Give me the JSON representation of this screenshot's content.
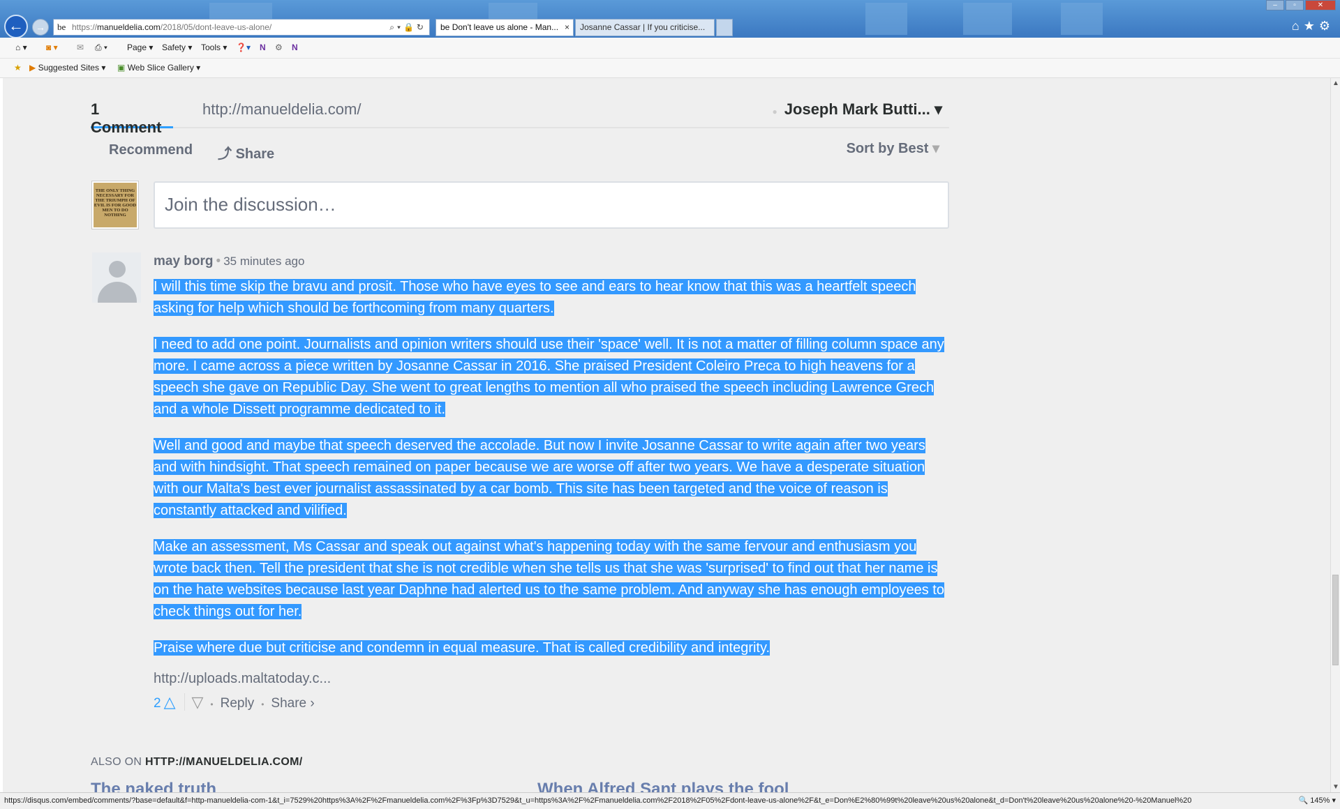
{
  "browser": {
    "address_prefix": "https://",
    "address_main": "manueldelia.com",
    "address_rest": "/2018/05/dont-leave-us-alone/",
    "tabs": [
      {
        "label": "Don't leave us alone - Man..."
      },
      {
        "label": "Josanne Cassar | If you criticise..."
      }
    ],
    "tab_close": "×",
    "favicon_letter": "be",
    "window_buttons": [
      "–",
      "▫",
      "✕"
    ],
    "right_icons": "⌂★⚙"
  },
  "command_bar": {
    "page": "Page",
    "safety": "Safety",
    "tools": "Tools"
  },
  "favorites_bar": {
    "suggested_sites": "Suggested Sites",
    "web_slice_gallery": "Web Slice Gallery"
  },
  "disqus": {
    "comment_count": "1 Comment",
    "site_link": "http://manueldelia.com/",
    "user_name": "Joseph Mark Butti...",
    "recommend": "Recommend",
    "share": "Share",
    "sort": "Sort by Best",
    "composer_placeholder": "Join the discussion…",
    "avatar_quote": "THE ONLY THING NECESSARY FOR THE TRIUMPH OF EVIL IS FOR GOOD MEN TO DO NOTHING",
    "post": {
      "author": "may borg",
      "time": "35 minutes ago",
      "paragraphs": [
        "I will this time skip the bravu and prosit. Those who have eyes to see and ears to hear know that this was a heartfelt speech asking for help which should be forthcoming from many quarters.",
        "I need to add one point. Journalists and opinion writers should use their 'space' well. It is not a matter of filling column space any more. I came across a piece written by Josanne Cassar in 2016. She praised President Coleiro Preca to high heavens for a speech she gave on Republic Day. She went to great lengths to mention all who praised the speech including Lawrence Grech and a whole Dissett programme dedicated to it.",
        "Well and good and maybe that speech deserved the accolade. But now I invite Josanne Cassar to write again after two years and with hindsight. That speech remained on paper because we are worse off after two years. We have a desperate situation with our Malta's best ever journalist assassinated by a car bomb. This site has been targeted and the voice of reason is constantly attacked and vilified.",
        "Make an assessment, Ms Cassar and speak out against what's happening today with the same fervour and enthusiasm you wrote back then. Tell the president that she is not credible when she tells us that she was 'surprised' to find out that her name is on the hate websites because last year Daphne had alerted us to the same problem. And anyway she has enough employees to check things out for her.",
        "Praise where due but criticise and condemn in equal measure. That is called credibility and integrity."
      ],
      "link": "http://uploads.maltatoday.c...",
      "votes": "2",
      "reply": "Reply",
      "share": "Share ›"
    },
    "also_on_prefix": "ALSO ON",
    "also_on_site": "HTTP://MANUELDELIA.COM/",
    "stories": [
      "The naked truth",
      "When Alfred Sant plays the fool"
    ]
  },
  "status_bar": {
    "url": "https://disqus.com/embed/comments/?base=default&f=http-manueldelia-com-1&t_i=7529%20https%3A%2F%2Fmanueldelia.com%2F%3Fp%3D7529&t_u=https%3A%2F%2Fmanueldelia.com%2F2018%2F05%2Fdont-leave-us-alone%2F&t_e=Don%E2%80%99t%20leave%20us%20alone&t_d=Don't%20leave%20us%20alone%20-%20Manuel%20",
    "zoom": "145%"
  },
  "colors": {
    "selection": "#3399ff",
    "accent": "#2e9fff",
    "text_muted": "#656c7a",
    "titlebar": "#3b78c1"
  }
}
